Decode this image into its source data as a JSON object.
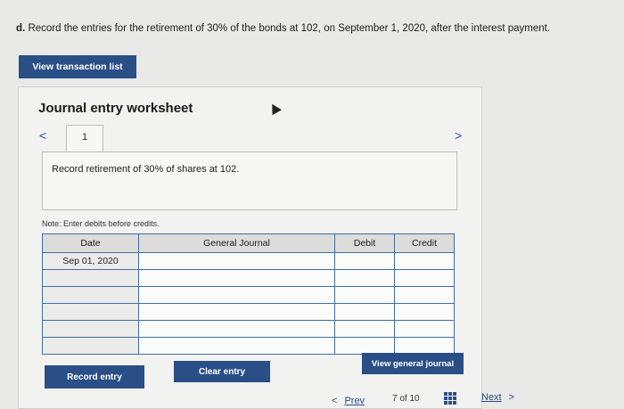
{
  "question": {
    "label": "d.",
    "text": "Record the entries for the retirement of 30% of the bonds at 102, on September 1, 2020, after the interest payment."
  },
  "view_transaction_list": "View transaction list",
  "worksheet": {
    "title": "Journal entry worksheet",
    "nav_prev": "<",
    "nav_next": ">",
    "tab_number": "1",
    "instruction": "Record retirement of 30% of shares at 102.",
    "note": "Note: Enter debits before credits.",
    "columns": [
      "Date",
      "General Journal",
      "Debit",
      "Credit"
    ],
    "rows": [
      {
        "date": "Sep 01, 2020",
        "account": "",
        "debit": "",
        "credit": ""
      },
      {
        "date": "",
        "account": "",
        "debit": "",
        "credit": ""
      },
      {
        "date": "",
        "account": "",
        "debit": "",
        "credit": ""
      },
      {
        "date": "",
        "account": "",
        "debit": "",
        "credit": ""
      },
      {
        "date": "",
        "account": "",
        "debit": "",
        "credit": ""
      },
      {
        "date": "",
        "account": "",
        "debit": "",
        "credit": ""
      }
    ],
    "record_entry": "Record entry",
    "clear_entry": "Clear entry",
    "view_general_journal": "View general journal"
  },
  "pager": {
    "prev_label": "Prev",
    "prev_icon": "<",
    "page": "7",
    "of": "of",
    "total": "10",
    "next_label": "Next",
    "next_icon": ">"
  },
  "colors": {
    "primary": "#2a4f86",
    "grid_border": "#3f6fa8",
    "background": "#e9e9e7"
  }
}
